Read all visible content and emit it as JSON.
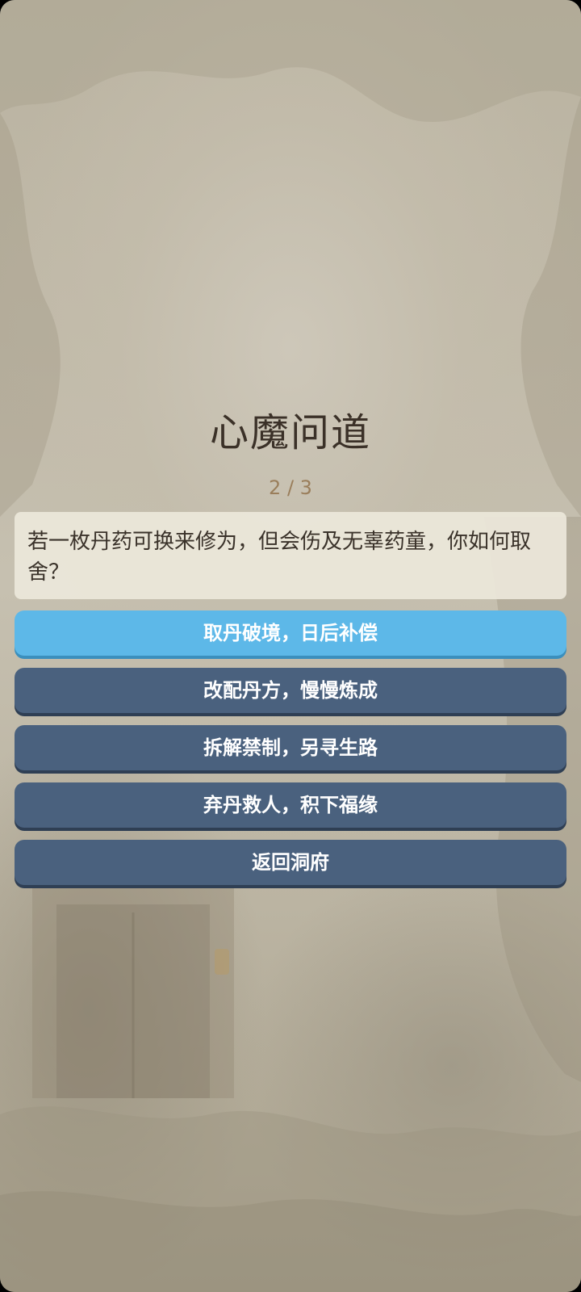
{
  "title": "心魔问道",
  "progress": "2 / 3",
  "question": "若一枚丹药可换来修为，但会伤及无辜药童，你如何取舍？",
  "options": [
    {
      "label": "取丹破境，日后补偿",
      "selected": true
    },
    {
      "label": "改配丹方，慢慢炼成",
      "selected": false
    },
    {
      "label": "拆解禁制，另寻生路",
      "selected": false
    },
    {
      "label": "弃丹救人，积下福缘",
      "selected": false
    }
  ],
  "back_label": "返回洞府",
  "colors": {
    "option_default": "#4a617e",
    "option_selected": "#5db8e8",
    "title_text": "#3b3128",
    "progress_text": "#9a7e5b"
  }
}
